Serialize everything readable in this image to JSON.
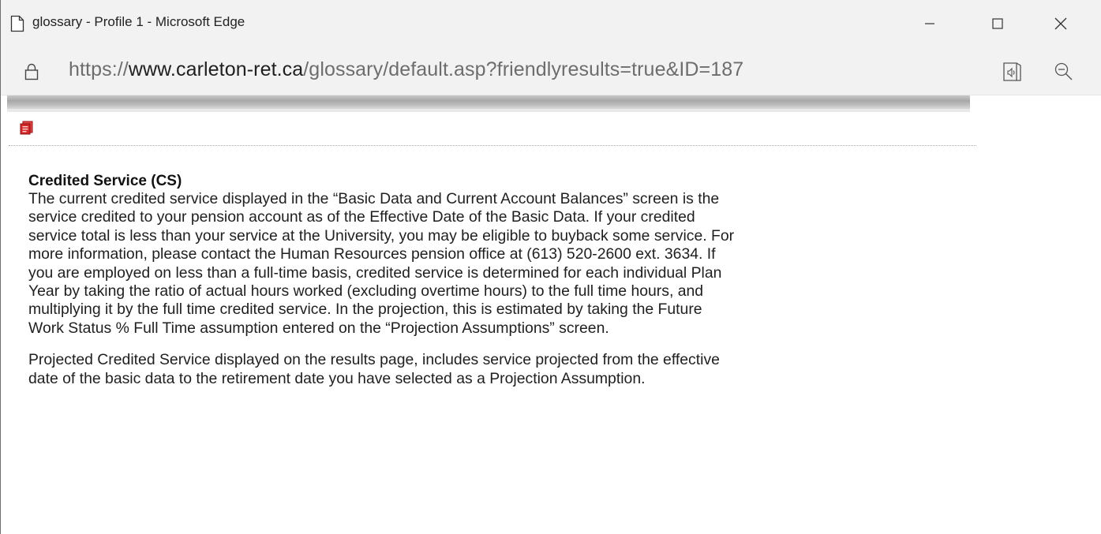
{
  "window": {
    "title": "glossary - Profile 1 - Microsoft Edge",
    "controls": {
      "minimize": "minimize-icon",
      "maximize": "maximize-icon",
      "close": "close-icon"
    }
  },
  "addressbar": {
    "url_prefix": "https://",
    "url_domain": "www.carleton-ret.ca",
    "url_path": "/glossary/default.asp?friendlyresults=true&ID=187",
    "icons": [
      "lock-icon",
      "read-aloud-icon",
      "zoom-out-icon"
    ]
  },
  "page": {
    "icon": "pdf-icon",
    "term": "Credited Service (CS)",
    "paragraphs": [
      "The current credited service displayed in the “Basic Data and Current Account Balances” screen is the\nservice credited to your pension account as of the Effective Date of the Basic Data. If your credited\nservice total is less than your service at the University, you may be eligible to buyback some service. For\nmore information, please contact the Human Resources pension office at (613) 520-2600 ext. 3634. If\nyou are employed on less than a full-time basis, credited service is determined for each individual Plan\nYear by taking the ratio of actual hours worked (excluding overtime hours) to the full time hours, and\nmultiplying it by the full time credited service. In the projection, this is estimated by taking the Future\nWork Status % Full Time assumption entered on the “Projection Assumptions” screen.",
      "Projected Credited Service displayed on the results page, includes service projected from the effective\ndate of the basic data to the retirement date you have selected as a Projection Assumption."
    ]
  },
  "colors": {
    "chrome_bg": "#f2f2f2",
    "url_domain": "#202020",
    "url_rest": "#6d6d6d",
    "pdf_icon": "#c8102e"
  }
}
